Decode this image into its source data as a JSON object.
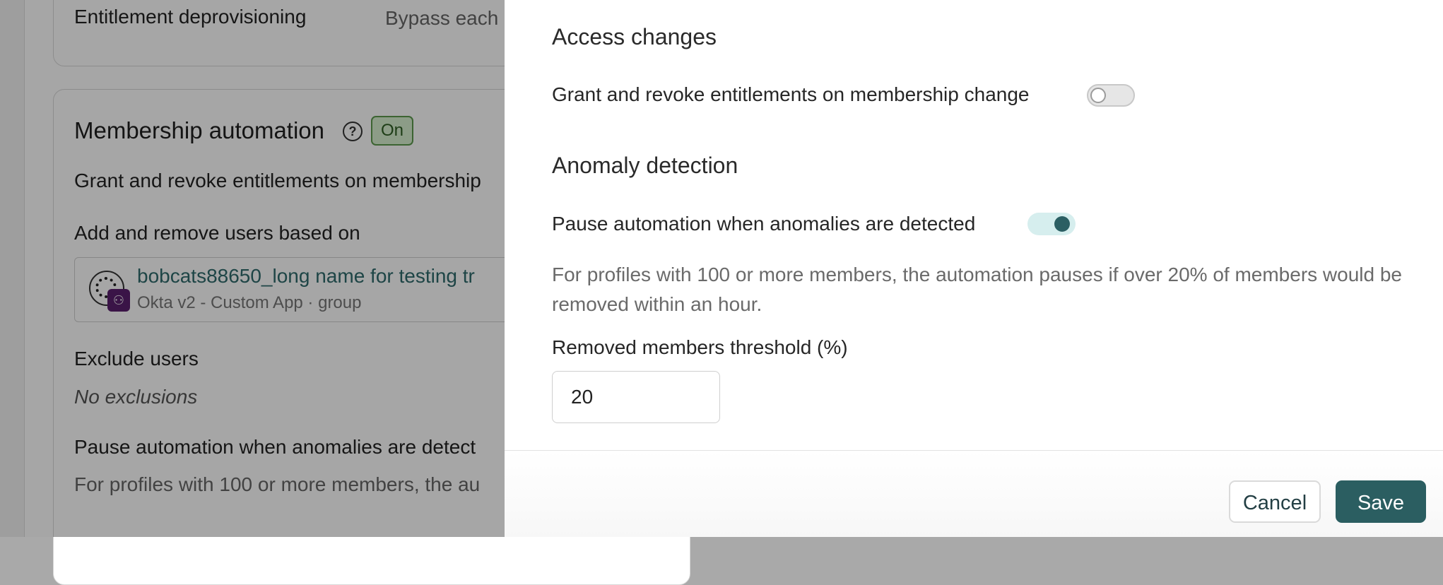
{
  "background": {
    "entitlement_deprovisioning_label": "Entitlement deprovisioning",
    "entitlement_deprovisioning_value": "Bypass each",
    "membership_automation_title": "Membership automation",
    "status_badge": "On",
    "grant_revoke_text": "Grant and revoke entitlements on membership",
    "add_remove_label": "Add and remove users based on",
    "group": {
      "name": "bobcats88650_long name for testing tr",
      "subtitle": "Okta v2 - Custom App · group"
    },
    "exclude_users_label": "Exclude users",
    "no_exclusions": "No exclusions",
    "pause_label": "Pause automation when anomalies are detect",
    "pause_desc": "For profiles with 100 or more members, the au"
  },
  "drawer": {
    "access_changes": {
      "heading": "Access changes",
      "grant_revoke_label": "Grant and revoke entitlements on membership change",
      "grant_revoke_enabled": false
    },
    "anomaly_detection": {
      "heading": "Anomaly detection",
      "pause_label": "Pause automation when anomalies are detected",
      "pause_enabled": true,
      "description": "For profiles with 100 or more members, the automation pauses if over 20% of members would be removed within an hour.",
      "threshold_label": "Removed members threshold (%)",
      "threshold_value": "20"
    },
    "footer": {
      "cancel_label": "Cancel",
      "save_label": "Save"
    }
  },
  "colors": {
    "accent": "#2b5e61",
    "status_on_bg": "#d7f0cf",
    "status_on_border": "#5c9a4e",
    "link": "#2e6a6c"
  },
  "icons": {
    "help": "help-circle-icon",
    "group": "group-icon",
    "users": "users-icon"
  }
}
